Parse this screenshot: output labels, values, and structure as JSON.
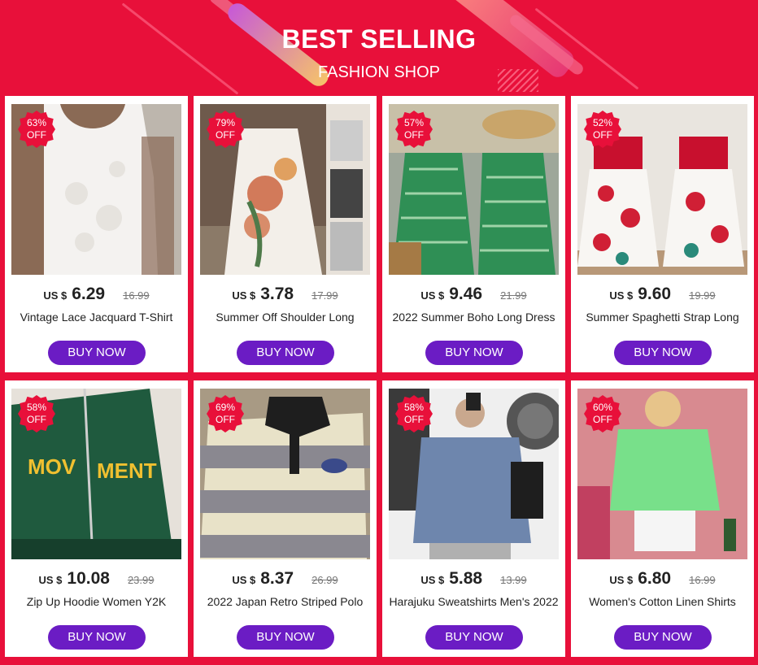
{
  "header": {
    "title": "BEST SELLING",
    "subtitle": "FASHION SHOP"
  },
  "currency_label": "US $",
  "buy_label": "BUY NOW",
  "colors": {
    "background": "#e8103a",
    "buy_button": "#6b1cc4",
    "badge": "#e8103a"
  },
  "products": [
    {
      "discount_pct": "63%",
      "discount_off": "OFF",
      "price": "6.29",
      "old_price": "16.99",
      "name": "Vintage Lace Jacquard T-Shirt",
      "image": "white-lace-top-photo"
    },
    {
      "discount_pct": "79%",
      "discount_off": "OFF",
      "price": "3.78",
      "old_price": "17.99",
      "name": "Summer Off Shoulder Long",
      "image": "floral-white-dress-photo"
    },
    {
      "discount_pct": "57%",
      "discount_off": "OFF",
      "price": "9.46",
      "old_price": "21.99",
      "name": "2022 Summer Boho Long Dress",
      "image": "green-boho-dress-photo"
    },
    {
      "discount_pct": "52%",
      "discount_off": "OFF",
      "price": "9.60",
      "old_price": "19.99",
      "name": "Summer Spaghetti Strap Long",
      "image": "red-floral-dress-photo"
    },
    {
      "discount_pct": "58%",
      "discount_off": "OFF",
      "price": "10.08",
      "old_price": "23.99",
      "name": "Zip Up Hoodie Women Y2K",
      "image": "green-hoodie-photo"
    },
    {
      "discount_pct": "69%",
      "discount_off": "OFF",
      "price": "8.37",
      "old_price": "26.99",
      "name": "2022 Japan Retro Striped Polo",
      "image": "striped-polo-photo"
    },
    {
      "discount_pct": "58%",
      "discount_off": "OFF",
      "price": "5.88",
      "old_price": "13.99",
      "name": "Harajuku Sweatshirts Men's 2022",
      "image": "blue-sweatshirt-photo"
    },
    {
      "discount_pct": "60%",
      "discount_off": "OFF",
      "price": "6.80",
      "old_price": "16.99",
      "name": "Women's Cotton Linen Shirts",
      "image": "green-linen-shirt-photo"
    }
  ]
}
